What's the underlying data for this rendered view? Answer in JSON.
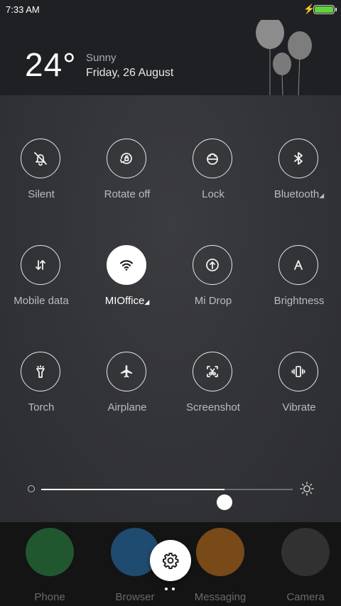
{
  "status_bar": {
    "time": "7:33 AM"
  },
  "weather": {
    "temperature": "24°",
    "condition": "Sunny",
    "date": "Friday, 26 August"
  },
  "toggles": [
    {
      "label": "Silent",
      "icon": "bell-off-icon",
      "active": false,
      "has_menu": false
    },
    {
      "label": "Rotate off",
      "icon": "rotate-lock-icon",
      "active": false,
      "has_menu": false
    },
    {
      "label": "Lock",
      "icon": "lock-icon",
      "active": false,
      "has_menu": false
    },
    {
      "label": "Bluetooth",
      "icon": "bluetooth-icon",
      "active": false,
      "has_menu": true
    },
    {
      "label": "Mobile data",
      "icon": "mobile-data-icon",
      "active": false,
      "has_menu": false
    },
    {
      "label": "MIOffice",
      "icon": "wifi-icon",
      "active": true,
      "has_menu": true
    },
    {
      "label": "Mi Drop",
      "icon": "mi-drop-icon",
      "active": false,
      "has_menu": false
    },
    {
      "label": "Brightness",
      "icon": "brightness-auto-icon",
      "active": false,
      "has_menu": false
    },
    {
      "label": "Torch",
      "icon": "torch-icon",
      "active": false,
      "has_menu": false
    },
    {
      "label": "Airplane",
      "icon": "airplane-icon",
      "active": false,
      "has_menu": false
    },
    {
      "label": "Screenshot",
      "icon": "screenshot-icon",
      "active": false,
      "has_menu": false
    },
    {
      "label": "Vibrate",
      "icon": "vibrate-icon",
      "active": false,
      "has_menu": false
    }
  ],
  "brightness": {
    "level": 0.73
  },
  "dock": [
    {
      "label": "Phone",
      "icon": "phone-icon",
      "color": "#2fa84f"
    },
    {
      "label": "Browser",
      "icon": "browser-icon",
      "color": "#2f8ee0"
    },
    {
      "label": "Messaging",
      "icon": "messaging-icon",
      "color": "#f08c1c"
    },
    {
      "label": "Camera",
      "icon": "camera-icon",
      "color": "#555555"
    }
  ],
  "colors": {
    "accent_active": "#ffffff",
    "label_inactive": "#b9bbbf",
    "battery": "#5fd33c"
  }
}
